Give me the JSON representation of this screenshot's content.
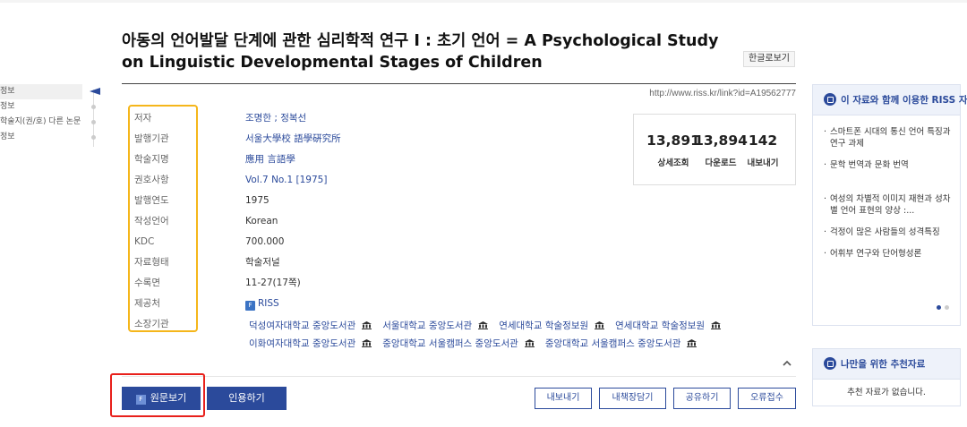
{
  "sidenav": [
    "정보",
    "정보",
    "학술지(권/호) 다른 논문",
    "정보"
  ],
  "article": {
    "title_line1": "아동의 언어발달 단계에 관한 심리학적 연구 Ⅰ : 초기 언어 = A Psychological Study",
    "title_line2": "on Linguistic Developmental Stages of Children",
    "korean_view_label": "한글로보기",
    "url": "http://www.riss.kr/link?id=A19562777"
  },
  "meta": [
    {
      "label": "저자",
      "value": "조명한 ; 정복선"
    },
    {
      "label": "발행기관",
      "value": "서울大學校 語學硏究所"
    },
    {
      "label": "학술지명",
      "value": "應用 言語學"
    },
    {
      "label": "권호사항",
      "value": "Vol.7 No.1 [1975]"
    },
    {
      "label": "발행연도",
      "value": "1975"
    },
    {
      "label": "작성언어",
      "value": "Korean"
    },
    {
      "label": "KDC",
      "value": "700.000"
    },
    {
      "label": "자료형태",
      "value": "학술저널"
    },
    {
      "label": "수록면",
      "value": "11-27(17쪽)"
    },
    {
      "label": "제공처",
      "value": "RISS"
    },
    {
      "label": "소장기관",
      "value": ""
    }
  ],
  "provider_badge": "F",
  "libraries": [
    [
      "덕성여자대학교 중앙도서관",
      "서울대학교 중앙도서관",
      "연세대학교 학술정보원",
      "연세대학교 학술정보원"
    ],
    [
      "이화여자대학교 중앙도서관",
      "중앙대학교 서울캠퍼스 중앙도서관",
      "중앙대학교 서울캠퍼스 중앙도서관"
    ]
  ],
  "stats": [
    {
      "value": "13,891",
      "label": "상세조회"
    },
    {
      "value": "13,894",
      "label": "다운로드"
    },
    {
      "value": "142",
      "label": "내보내기"
    }
  ],
  "buttons": {
    "original_icon": "F",
    "original": "원문보기",
    "cite": "인용하기",
    "export": "내보내기",
    "bookshelf": "내책장담기",
    "share": "공유하기",
    "report": "오류접수"
  },
  "related": {
    "title": "이 자료와 함께 이용한 RISS 자료",
    "items": [
      "스마트폰 시대의 통신 언어 특징과 연구 과제",
      "문학 번역과 문화 번역",
      "여성의 차별적 이미지 재현과 성차별 언어 표현의 양상 :...",
      "걱정이 많은 사람들의 성격특징",
      "어휘부 연구와 단어형성론"
    ]
  },
  "recommend": {
    "title": "나만을 위한 추천자료",
    "empty": "추천 자료가 없습니다."
  },
  "colors": {
    "accent": "#2b4a9b",
    "highlight_yellow": "#f5b61b",
    "highlight_red": "#e8201b"
  }
}
